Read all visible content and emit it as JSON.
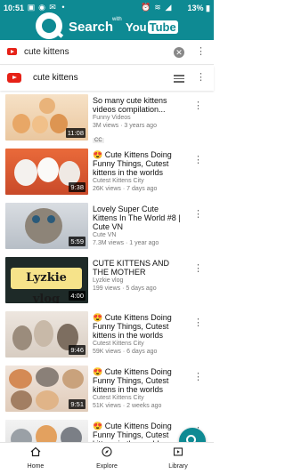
{
  "status": {
    "time": "10:51",
    "battery": "13%"
  },
  "brand": {
    "name": "Search",
    "with": "with",
    "you": "You",
    "tube": "Tube"
  },
  "search": {
    "query": "cute kittens"
  },
  "youtube_header": {
    "query": "cute kittens"
  },
  "videos": [
    {
      "title": "So many cute kittens videos compilation...",
      "channel": "Funny Videos",
      "stats": "3M views · 3 years ago",
      "duration": "11:08",
      "badge": "CC"
    },
    {
      "title": "😍 Cute Kittens Doing Funny Things, Cutest kittens in the worlds",
      "channel": "Cutest Kittens City",
      "stats": "26K views · 7 days ago",
      "duration": "9:38"
    },
    {
      "title": "Lovely Super Cute Kittens In The World #8 | Cute VN",
      "channel": "Cute VN",
      "stats": "7.3M views · 1 year ago",
      "duration": "5:59"
    },
    {
      "title": "CUTE KITTENS AND THE MOTHER",
      "channel": "Lyzkie vlog",
      "stats": "199 views · 5 days ago",
      "duration": "4:00",
      "thumb_text": "Lyzkie vlog"
    },
    {
      "title": "😍 Cute Kittens Doing Funny Things, Cutest kittens in the worlds",
      "channel": "Cutest Kittens City",
      "stats": "59K views · 6 days ago",
      "duration": "9:46"
    },
    {
      "title": "😍 Cute Kittens Doing Funny Things, Cutest kittens in the worlds",
      "channel": "Cutest Kittens City",
      "stats": "51K views · 2 weeks ago",
      "duration": "9:51"
    },
    {
      "title": "😍 Cute Kittens Doing Funny Things, Cutest kittens in the worlds",
      "channel": "",
      "stats": "",
      "duration": ""
    }
  ],
  "bottom_nav": [
    {
      "label": "Home",
      "icon": "home-icon"
    },
    {
      "label": "Explore",
      "icon": "compass-icon"
    },
    {
      "label": "Library",
      "icon": "library-icon"
    }
  ],
  "colors": {
    "primary": "#0e8a93",
    "youtube_red": "#e62117"
  }
}
